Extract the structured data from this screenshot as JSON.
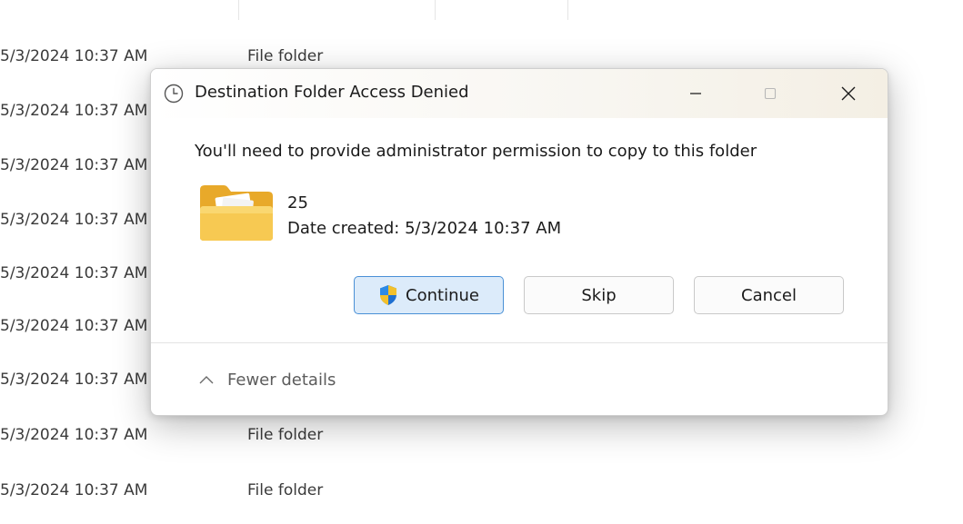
{
  "background_list": {
    "rows": [
      {
        "date": "5/3/2024 10:37 AM",
        "type": "File folder"
      },
      {
        "date": "5/3/2024 10:37 AM",
        "type": ""
      },
      {
        "date": "5/3/2024 10:37 AM",
        "type": ""
      },
      {
        "date": "5/3/2024 10:37 AM",
        "type": ""
      },
      {
        "date": "5/3/2024 10:37 AM",
        "type": ""
      },
      {
        "date": "5/3/2024 10:37 AM",
        "type": ""
      },
      {
        "date": "5/3/2024 10:37 AM",
        "type": ""
      },
      {
        "date": "5/3/2024 10:37 AM",
        "type": "File folder"
      },
      {
        "date": "5/3/2024 10:37 AM",
        "type": "File folder"
      }
    ]
  },
  "dialog": {
    "title": "Destination Folder Access Denied",
    "title_icon": "clock-icon",
    "message": "You'll need to provide administrator permission to copy to this folder",
    "item": {
      "icon": "folder-icon",
      "name": "25",
      "date_created": "Date created: 5/3/2024 10:37 AM"
    },
    "buttons": {
      "continue": "Continue",
      "skip": "Skip",
      "cancel": "Cancel"
    },
    "details_toggle": "Fewer details",
    "colors": {
      "continue_bg": "#dcebfa",
      "continue_border": "#4a90d6",
      "folder": "#f5c24a"
    }
  }
}
